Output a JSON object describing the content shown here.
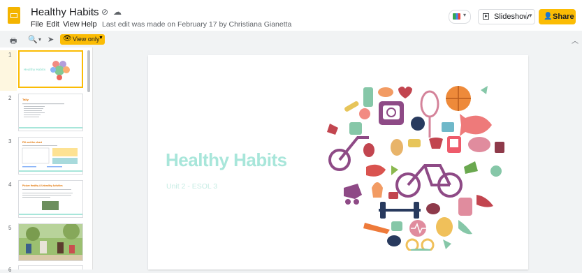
{
  "app": {
    "title": "Healthy Habits",
    "menu": [
      "File",
      "Edit",
      "View",
      "Help"
    ],
    "last_edit": "Last edit was made on February 17 by Christiana Gianetta"
  },
  "header": {
    "slideshow_label": "Slideshow",
    "share_label": "Share"
  },
  "toolbar": {
    "view_only_label": "View only"
  },
  "filmstrip": {
    "slides": [
      {
        "number": "1",
        "title": "Healthy Habits"
      },
      {
        "number": "2",
        "title": "Tally"
      },
      {
        "number": "3",
        "title": "Fill out the chart"
      },
      {
        "number": "4",
        "title": "Picture Healthy & Unhealthy Activities"
      },
      {
        "number": "5",
        "title": ""
      },
      {
        "number": "6",
        "title": ""
      }
    ]
  },
  "slide": {
    "title": "Healthy Habits",
    "subtitle": "Unit 2 - ESOL 3"
  },
  "colors": {
    "accent": "#fbbc04",
    "title_teal": "#a8e6da",
    "logo_yellow": "#f4b400"
  }
}
